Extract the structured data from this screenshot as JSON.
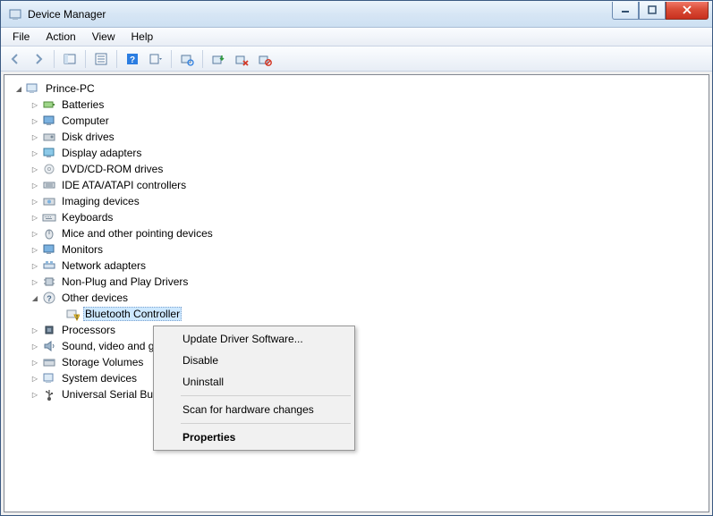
{
  "window": {
    "title": "Device Manager"
  },
  "menu": {
    "file": "File",
    "action": "Action",
    "view": "View",
    "help": "Help"
  },
  "tree": {
    "root": "Prince-PC",
    "categories": [
      {
        "label": "Batteries"
      },
      {
        "label": "Computer"
      },
      {
        "label": "Disk drives"
      },
      {
        "label": "Display adapters"
      },
      {
        "label": "DVD/CD-ROM drives"
      },
      {
        "label": "IDE ATA/ATAPI controllers"
      },
      {
        "label": "Imaging devices"
      },
      {
        "label": "Keyboards"
      },
      {
        "label": "Mice and other pointing devices"
      },
      {
        "label": "Monitors"
      },
      {
        "label": "Network adapters"
      },
      {
        "label": "Non-Plug and Play Drivers"
      },
      {
        "label": "Other devices",
        "expanded": true,
        "children": [
          {
            "label": "Bluetooth Controller",
            "selected": true,
            "warning": true
          }
        ]
      },
      {
        "label": "Processors"
      },
      {
        "label": "Sound, video and game controllers"
      },
      {
        "label": "Storage Volumes"
      },
      {
        "label": "System devices"
      },
      {
        "label": "Universal Serial Bus controllers"
      }
    ]
  },
  "context_menu": {
    "update": "Update Driver Software...",
    "disable": "Disable",
    "uninstall": "Uninstall",
    "scan": "Scan for hardware changes",
    "properties": "Properties"
  }
}
